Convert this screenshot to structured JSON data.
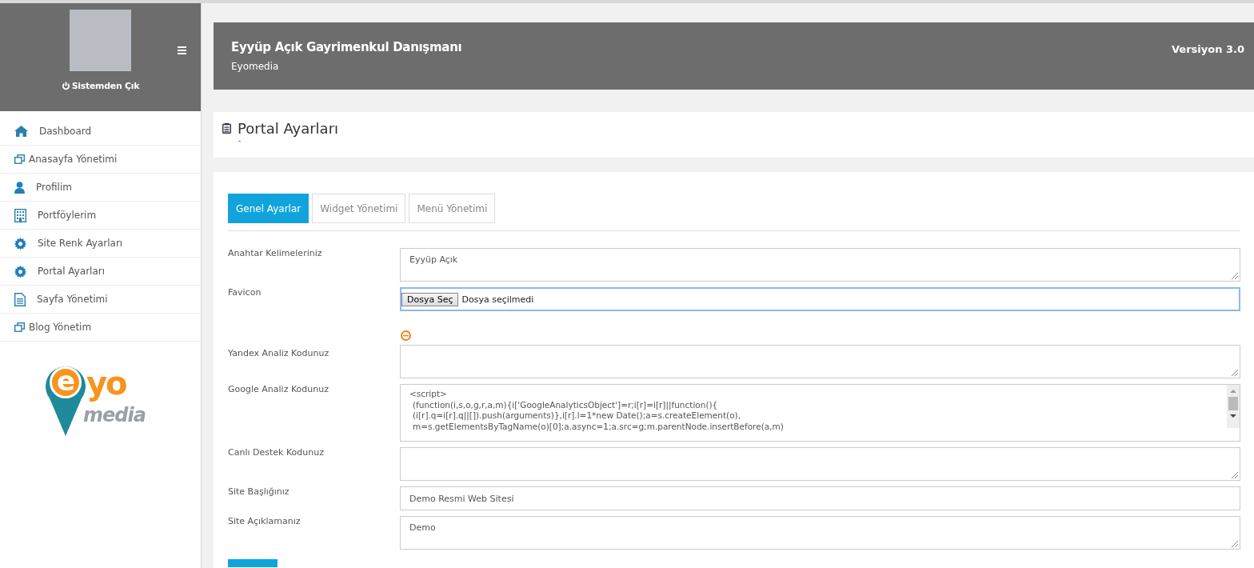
{
  "sidebar": {
    "logout": "Sistemden Çık",
    "items": [
      {
        "label": "Dashboard"
      },
      {
        "label": "Anasayfa Yönetimi"
      },
      {
        "label": "Profilim"
      },
      {
        "label": "Portföylerim"
      },
      {
        "label": "Site Renk Ayarları"
      },
      {
        "label": "Portal Ayarları"
      },
      {
        "label": "Sayfa Yönetimi"
      },
      {
        "label": "Blog Yönetim"
      }
    ],
    "logo": {
      "mark": "e",
      "word": "yo",
      "sub": "media"
    }
  },
  "header": {
    "title": "Eyyüp Açık Gayrimenkul Danışmanı",
    "subtitle": "Eyomedia",
    "version": "Versiyon 3.0"
  },
  "page": {
    "title": "Portal Ayarları",
    "subtitle": "-"
  },
  "tabs": [
    {
      "label": "Genel Ayarlar",
      "selected": true
    },
    {
      "label": "Widget Yönetimi",
      "selected": false
    },
    {
      "label": "Menü Yönetimi",
      "selected": false
    }
  ],
  "fields": [
    {
      "kind": "textarea",
      "label": "Anahtar Kelimeleriniz",
      "lines": [
        "Eyyüp Açık"
      ]
    },
    {
      "kind": "file",
      "label": "Favicon",
      "button": "Dosya Seç",
      "value": "Dosya seçilmedi"
    },
    {
      "kind": "textarea",
      "label": "Yandex Analiz Kodunuz"
    },
    {
      "kind": "code",
      "label": "Google Analiz Kodunuz",
      "lines": [
        "<script>",
        " (function(i,s,o,g,r,a,m){i['GoogleAnalyticsObject']=r;i[r]=i[r]||function(){",
        " (i[r].q=i[r].q||[]).push(arguments)},i[r].l=1*new Date();a=s.createElement(o),",
        " m=s.getElementsByTagName(o)[0];a.async=1;a.src=g;m.parentNode.insertBefore(a,m)"
      ]
    },
    {
      "kind": "textarea",
      "label": "Canlı Destek Kodunuz"
    },
    {
      "kind": "input",
      "label": "Site Başlığınız",
      "lines": [
        "Demo Resmi Web Sitesi"
      ]
    },
    {
      "kind": "textarea",
      "label": "Site Açıklamanız",
      "lines": [
        "Demo"
      ]
    }
  ]
}
